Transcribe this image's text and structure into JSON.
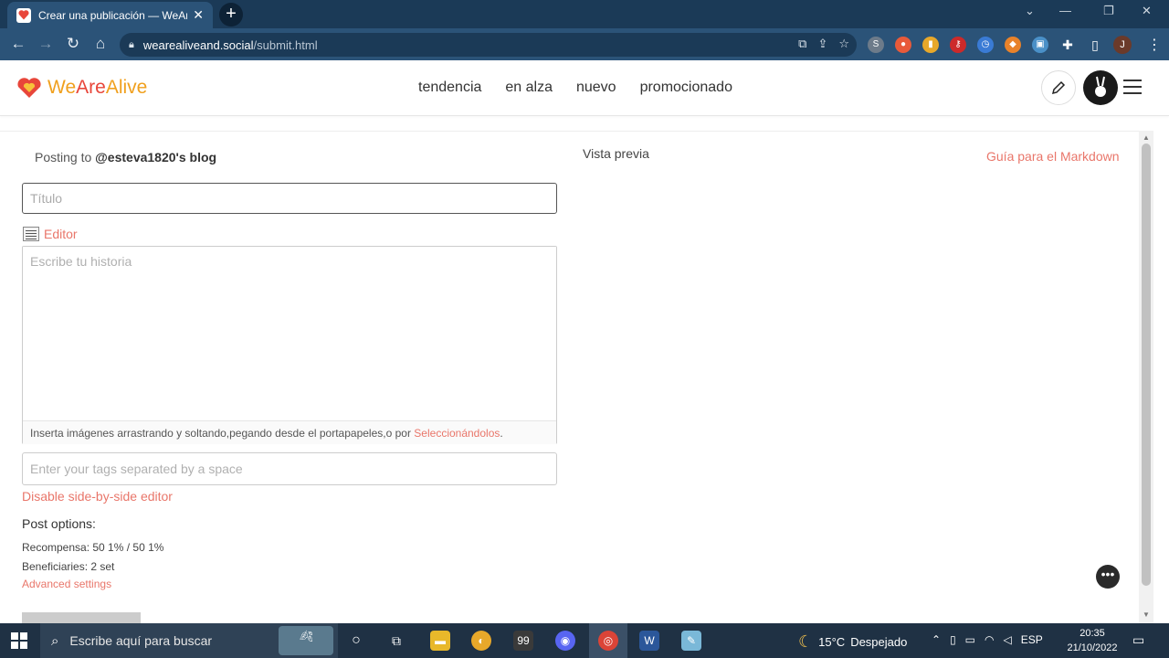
{
  "browser": {
    "tab_title": "Crear una publicación — WeAreA",
    "tab_close": "✕",
    "new_tab": "+",
    "url_host": "wearealiveand.social",
    "url_path": "/submit.html",
    "profile_initial": "J"
  },
  "site": {
    "logo_we": "We",
    "logo_are": "Are",
    "logo_alive": "Alive",
    "nav": [
      "tendencia",
      "en alza",
      "nuevo",
      "promocionado"
    ]
  },
  "composer": {
    "posting_prefix": "Posting to",
    "posting_account": "@esteva1820's blog",
    "title_placeholder": "Título",
    "editor_label": "Editor",
    "story_placeholder": "Escribe tu historia",
    "upload_hint": "Inserta imágenes arrastrando y soltando,pegando desde el portapapeles,o por",
    "upload_link": "Seleccionándolos",
    "upload_hint_end": ".",
    "tags_placeholder": "Enter your tags separated by a space",
    "disable_sbs": "Disable side-by-side editor",
    "post_options": "Post options:",
    "reward": "Recompensa: 50 1% / 50 1%",
    "beneficiaries": "Beneficiaries: 2 set",
    "advanced": "Advanced settings",
    "preview_label": "Vista previa",
    "markdown_guide": "Guía para el Markdown"
  },
  "taskbar": {
    "search_text": "Escribe aquí para buscar",
    "weather_temp": "15°C",
    "weather_desc": "Despejado",
    "lang": "ESP",
    "time": "20:35",
    "date": "21/10/2022"
  },
  "colors": {
    "accent": "#e9766a",
    "logo_orange": "#f0a01e",
    "logo_red": "#e8463a",
    "chrome_dark": "#1b3a57",
    "chrome": "#2b5378",
    "taskbar": "#1f3144"
  }
}
